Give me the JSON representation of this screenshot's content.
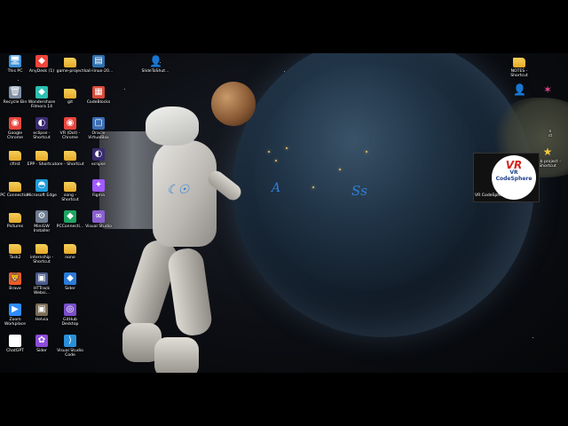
{
  "desktop_icons": [
    {
      "label": "This PC",
      "glyph": "🖥",
      "color": "#3a8fd8"
    },
    {
      "label": "Recycle Bin",
      "glyph": "🗑",
      "color": "#7d8ea3"
    },
    {
      "label": "Google Chrome",
      "glyph": "◉",
      "color": "#e8453c"
    },
    {
      "label": "cfirst",
      "glyph": "",
      "color": "folder"
    },
    {
      "label": "PC Connection",
      "glyph": "",
      "color": "folder"
    },
    {
      "label": "Pictures",
      "glyph": "",
      "color": "folder"
    },
    {
      "label": "Task2",
      "glyph": "",
      "color": "folder"
    },
    {
      "label": "Brave",
      "glyph": "🦁",
      "color": "#f05a24"
    },
    {
      "label": "Zoom Workplace",
      "glyph": "▶",
      "color": "#2d8cff"
    },
    {
      "label": "ChatGPT",
      "glyph": "✺",
      "color": "#ffffff"
    },
    {
      "label": "AnyDesk (1)",
      "glyph": "◆",
      "color": "#ef443b"
    },
    {
      "label": "Wondershare Filmora 14",
      "glyph": "◆",
      "color": "#2ac0b0"
    },
    {
      "label": "eclipse - Shortcut",
      "glyph": "◐",
      "color": "#3a2b6e"
    },
    {
      "label": "EPP - Shortcut",
      "glyph": "",
      "color": "folder"
    },
    {
      "label": "Microsoft Edge",
      "glyph": "◓",
      "color": "#1f9cd8"
    },
    {
      "label": "MiniGW Installer",
      "glyph": "⚙",
      "color": "#6d7b8e"
    },
    {
      "label": "internship - Shortcut",
      "glyph": "",
      "color": "folder"
    },
    {
      "label": "HTTrack Websi...",
      "glyph": "▣",
      "color": "#4a5a8a"
    },
    {
      "label": "Helvia",
      "glyph": "▣",
      "color": "#7a6c55"
    },
    {
      "label": "Sider",
      "glyph": "✿",
      "color": "#8c4bd8"
    },
    {
      "label": "game-project",
      "glyph": "",
      "color": "folder"
    },
    {
      "label": "git",
      "glyph": "",
      "color": "folder"
    },
    {
      "label": "VR (Dot) - Chrome",
      "glyph": "◉",
      "color": "#e8453c"
    },
    {
      "label": "ore - Shortcut",
      "glyph": "",
      "color": "folder"
    },
    {
      "label": "song - Shortcut",
      "glyph": "",
      "color": "folder"
    },
    {
      "label": "PCConnecti...",
      "glyph": "◆",
      "color": "#1fa463"
    },
    {
      "label": "none",
      "glyph": "",
      "color": "folder"
    },
    {
      "label": "Sider",
      "glyph": "◆",
      "color": "#2a7bd8"
    },
    {
      "label": "GitHub Desktop",
      "glyph": "◎",
      "color": "#7a4fc9"
    },
    {
      "label": "Visual Studio Code",
      "glyph": "⟩",
      "color": "#2a8fd8"
    },
    {
      "label": "kali-linux-20...",
      "glyph": "▤",
      "color": "#2f6fb0"
    },
    {
      "label": "CodeBlocks",
      "glyph": "▦",
      "color": "#d84a3a"
    },
    {
      "label": "Oracle VirtualBox",
      "glyph": "▢",
      "color": "#3a6fb5"
    },
    {
      "label": "eclipse",
      "glyph": "◐",
      "color": "#3a2b6e"
    },
    {
      "label": "Figma",
      "glyph": "✦",
      "color": "#a259ff"
    },
    {
      "label": "Visual Studio",
      "glyph": "∞",
      "color": "#8a5fd0"
    },
    {
      "label": "SlideToShut...",
      "glyph": "👤",
      "color": "#2ab0a0"
    },
    {
      "label": "NOTES - Shortcut",
      "glyph": "",
      "color": "folder"
    },
    {
      "label": "web project - Shortcut",
      "glyph": "★",
      "color": "#f5c842"
    }
  ],
  "right_icons": [
    {
      "glyph": "👤",
      "color": "#2ab0a0",
      "label": ""
    },
    {
      "glyph": "✶",
      "color": "#e84393",
      "label": ""
    }
  ],
  "clipped_labels": {
    "r": "n",
    "ct": "ct"
  },
  "logo": {
    "title": "VR CodeSphere",
    "caption": "VR CodeSphere",
    "mark": "VR"
  },
  "annotations": {
    "a1": "☾☉",
    "a2": "A",
    "a3": "Ss"
  }
}
